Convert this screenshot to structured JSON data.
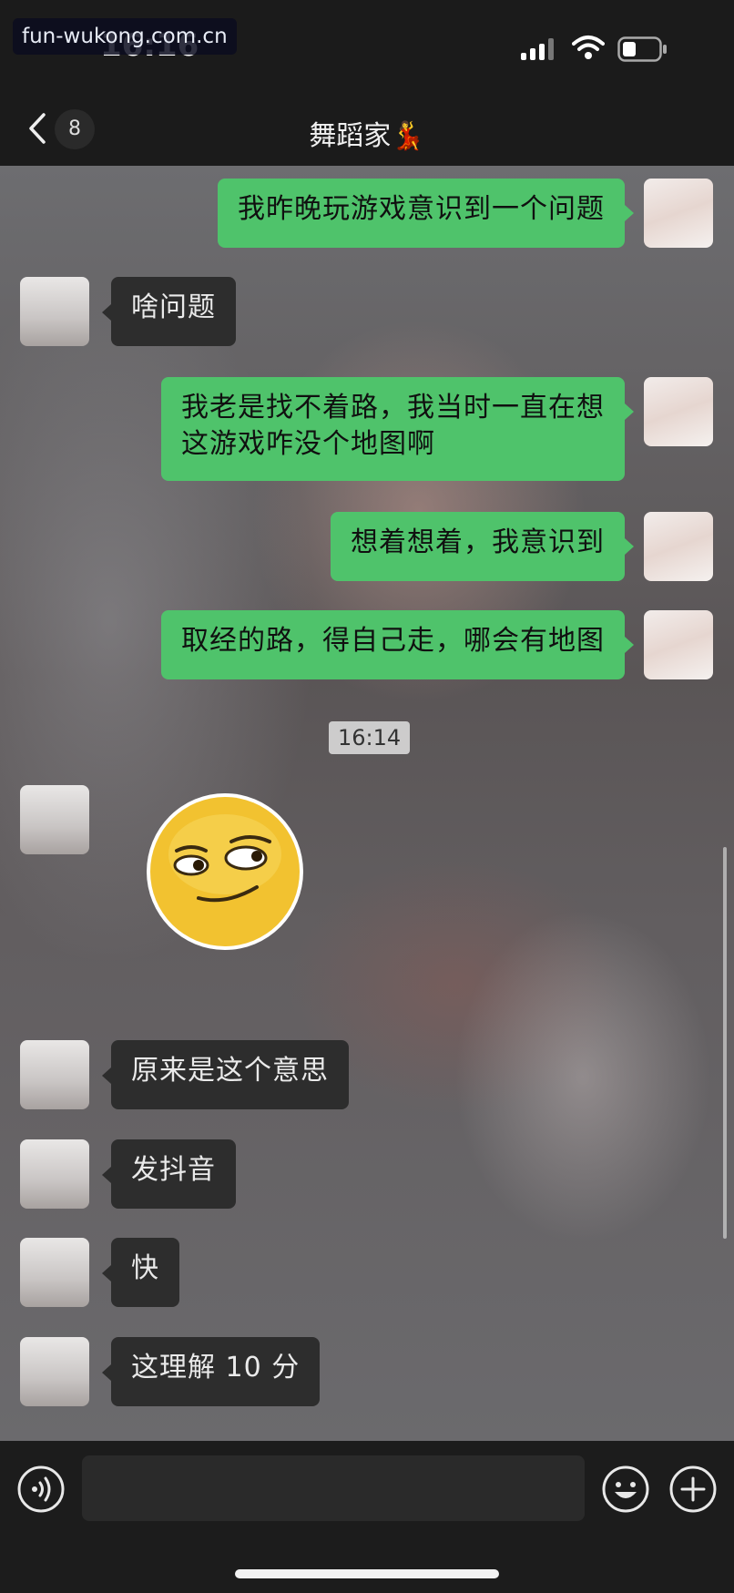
{
  "status_bar": {
    "time": "16:16",
    "watermark": "fun-wukong.com.cn"
  },
  "header": {
    "unread_count": "8",
    "title": "舞蹈家💃"
  },
  "messages": [
    {
      "from": "me",
      "text": "我昨晚玩游戏意识到一个问题"
    },
    {
      "from": "other",
      "text": "啥问题"
    },
    {
      "from": "me",
      "text": "我老是找不着路，我当时一直在想\n这游戏咋没个地图啊"
    },
    {
      "from": "me",
      "text": "想着想着，我意识到"
    },
    {
      "from": "me",
      "text": "取经的路，得自己走，哪会有地图"
    },
    {
      "from": "other",
      "type": "sticker",
      "icon": "smirk-emoji"
    },
    {
      "from": "other",
      "text": "原来是这个意思"
    },
    {
      "from": "other",
      "text": "发抖音"
    },
    {
      "from": "other",
      "text": "快"
    },
    {
      "from": "other",
      "text": "这理解 10 分"
    }
  ],
  "time_divider": "16:14",
  "input": {
    "placeholder": "",
    "value": ""
  },
  "colors": {
    "bubble_me": "#4fc36b",
    "bubble_other": "#2d2d2d",
    "bar": "#1b1b1b"
  }
}
